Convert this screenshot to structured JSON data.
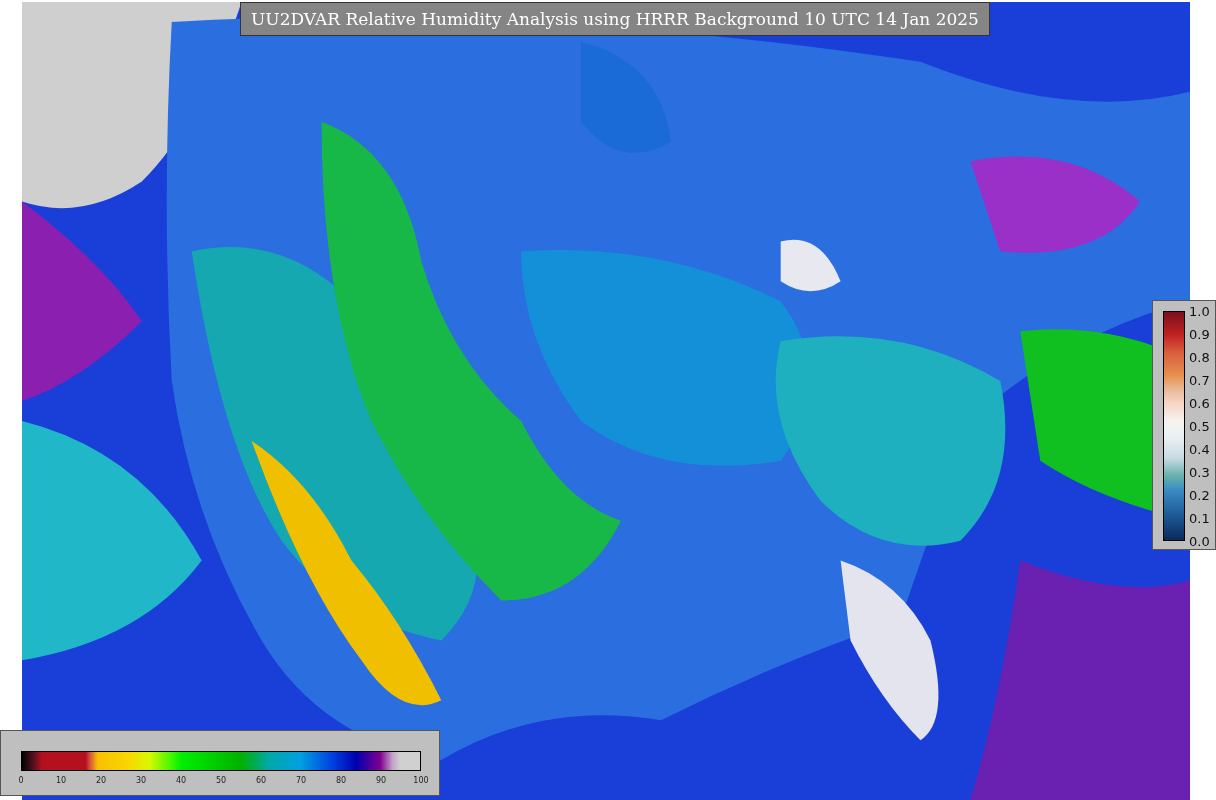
{
  "title": "UU2DVAR Relative Humidity Analysis using HRRR Background 10 UTC 14 Jan 2025",
  "side_legend": {
    "ticks": [
      "1.0",
      "0.9",
      "0.8",
      "0.7",
      "0.6",
      "0.5",
      "0.4",
      "0.3",
      "0.2",
      "0.1",
      "0.0"
    ]
  },
  "bottom_legend": {
    "ticks": [
      "0",
      "10",
      "20",
      "30",
      "40",
      "50",
      "60",
      "70",
      "80",
      "90",
      "100"
    ]
  }
}
